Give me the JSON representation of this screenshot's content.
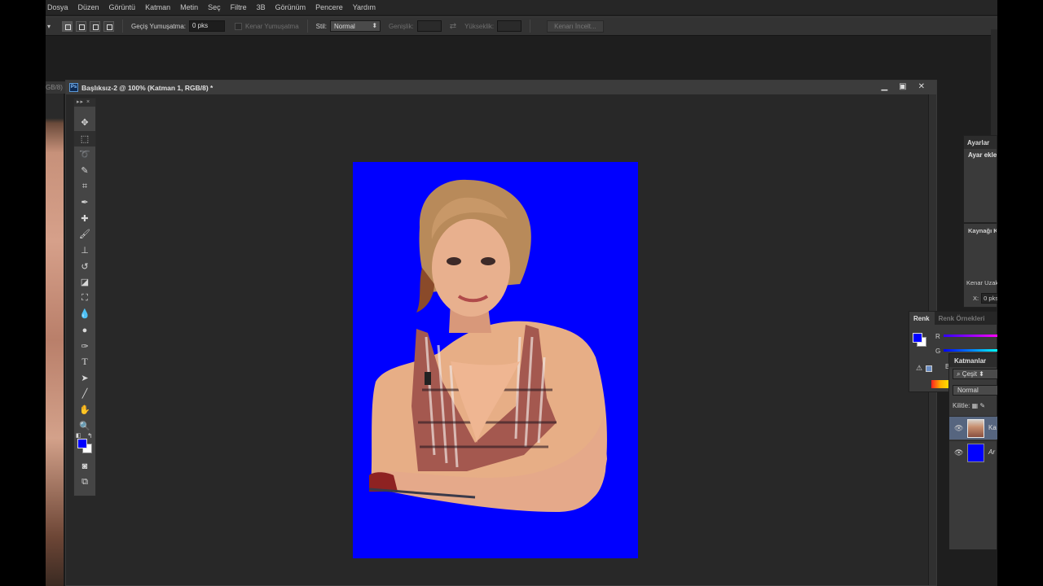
{
  "menu": [
    "Dosya",
    "Düzen",
    "Görüntü",
    "Katman",
    "Metin",
    "Seç",
    "Filtre",
    "3B",
    "Görünüm",
    "Pencere",
    "Yardım"
  ],
  "options": {
    "feather_label": "Geçiş Yumuşatma:",
    "feather_value": "0 pks",
    "antialias_label": "Kenar Yumuşatma",
    "style_label": "Stil:",
    "style_value": "Normal",
    "width_label": "Genişlik:",
    "height_label": "Yükseklik:",
    "refine_button": "Kenarı İncelt..."
  },
  "other_doc": {
    "tab_label": "GB/8)"
  },
  "document": {
    "badge": "Ps",
    "title": "Başlıksız-2 @ 100% (Katman 1, RGB/8) *",
    "background_color": "#0000ff"
  },
  "tools": {
    "header": "▸▸  ×",
    "items": [
      "move-tool",
      "marquee-tool",
      "lasso-tool",
      "quick-select-tool",
      "crop-tool",
      "eyedropper-tool",
      "healing-brush-tool",
      "brush-tool",
      "clone-stamp-tool",
      "history-brush-tool",
      "eraser-tool",
      "paint-bucket-tool",
      "blur-tool",
      "dodge-tool",
      "pen-tool",
      "type-tool",
      "path-select-tool",
      "line-tool",
      "hand-tool",
      "zoom-tool"
    ],
    "foreground_color": "#0000ff",
    "background_color": "#ffffff"
  },
  "panels": {
    "ayarlar": {
      "title": "Ayarlar",
      "text": "Ayar ekle"
    },
    "kaynak": {
      "title": "Kaynağı K",
      "edge_label": "Kenar Uzak",
      "x_label": "X:",
      "x_value": "0 pks"
    },
    "renk": {
      "tabs": [
        "Renk",
        "Renk Örnekleri"
      ],
      "channels": [
        "R",
        "G",
        "B"
      ],
      "fg_color": "#0000ff"
    },
    "katmanlar": {
      "title": "Katmanlar",
      "filter": "Çeşit",
      "blend": "Normal",
      "lock_label": "Kilitle:",
      "layers": [
        {
          "name": "Ka",
          "selected": true
        },
        {
          "name": "Ar",
          "selected": false,
          "color": "#0000ff"
        }
      ]
    }
  }
}
